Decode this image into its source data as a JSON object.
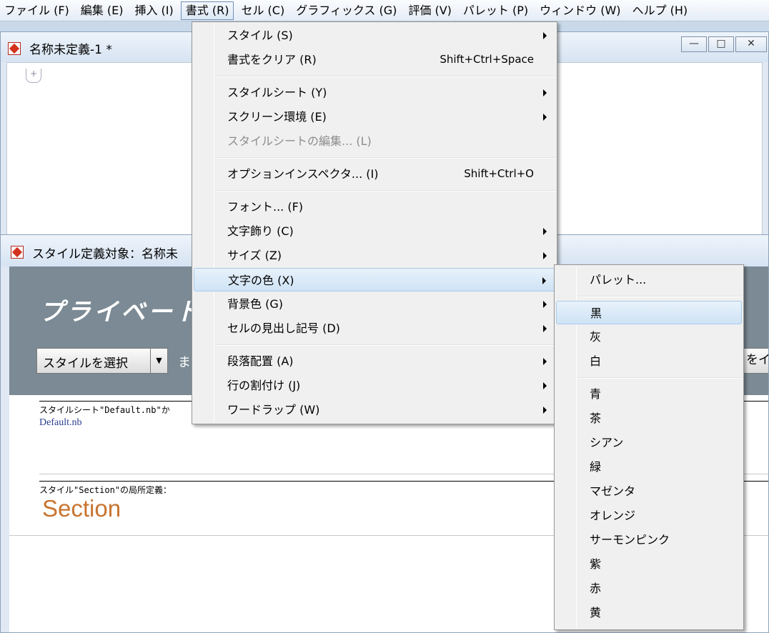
{
  "menubar": {
    "items": [
      {
        "label": "ファイル (F)"
      },
      {
        "label": "編集 (E)"
      },
      {
        "label": "挿入 (I)"
      },
      {
        "label": "書式 (R)"
      },
      {
        "label": "セル (C)"
      },
      {
        "label": "グラフィックス (G)"
      },
      {
        "label": "評価 (V)"
      },
      {
        "label": "パレット (P)"
      },
      {
        "label": "ウィンドウ (W)"
      },
      {
        "label": "ヘルプ (H)"
      }
    ],
    "active_index": 3
  },
  "notebook_window": {
    "title": "名称未定義-1 *",
    "cell_bracket": "+"
  },
  "stylesheet_window": {
    "title": "スタイル定義対象：名称未",
    "banner_title": "プライベート",
    "style_select_label": "スタイルを選択",
    "banner_text": "ま",
    "banner_button": "をイ",
    "stylesheet_note": "スタイルシート\"Default.nb\"か",
    "stylesheet_link": "Default.nb",
    "section_note": "スタイル\"Section\"の局所定義：",
    "section_sample": "Section"
  },
  "format_menu": {
    "groups": [
      [
        {
          "label": "スタイル (S)",
          "submenu": true
        },
        {
          "label": "書式をクリア (R)",
          "shortcut": "Shift+Ctrl+Space"
        }
      ],
      [
        {
          "label": "スタイルシート (Y)",
          "submenu": true
        },
        {
          "label": "スクリーン環境 (E)",
          "submenu": true
        },
        {
          "label": "スタイルシートの編集... (L)",
          "disabled": true
        }
      ],
      [
        {
          "label": "オプションインスペクタ... (I)",
          "shortcut": "Shift+Ctrl+O"
        }
      ],
      [
        {
          "label": "フォント... (F)"
        },
        {
          "label": "文字飾り (C)",
          "submenu": true
        },
        {
          "label": "サイズ (Z)",
          "submenu": true
        },
        {
          "label": "文字の色 (X)",
          "submenu": true,
          "highlighted": true
        },
        {
          "label": "背景色 (G)",
          "submenu": true
        },
        {
          "label": "セルの見出し記号 (D)",
          "submenu": true
        }
      ],
      [
        {
          "label": "段落配置 (A)",
          "submenu": true
        },
        {
          "label": "行の割付け (J)",
          "submenu": true
        },
        {
          "label": "ワードラップ (W)",
          "submenu": true
        }
      ]
    ]
  },
  "color_menu": {
    "groups": [
      [
        {
          "label": "パレット..."
        }
      ],
      [
        {
          "label": "黒",
          "highlighted": true
        },
        {
          "label": "灰"
        },
        {
          "label": "白"
        }
      ],
      [
        {
          "label": "青"
        },
        {
          "label": "茶"
        },
        {
          "label": "シアン"
        },
        {
          "label": "緑"
        },
        {
          "label": "マゼンタ"
        },
        {
          "label": "オレンジ"
        },
        {
          "label": "サーモンピンク"
        },
        {
          "label": "紫"
        },
        {
          "label": "赤"
        },
        {
          "label": "黄"
        }
      ]
    ]
  },
  "colors": {
    "menubar_bg": "#e4ecf6",
    "menu_bg": "#f0f0f0",
    "highlight": "#cfe3f5",
    "banner_bg": "#7b8a94",
    "section_color": "#c8742e"
  }
}
